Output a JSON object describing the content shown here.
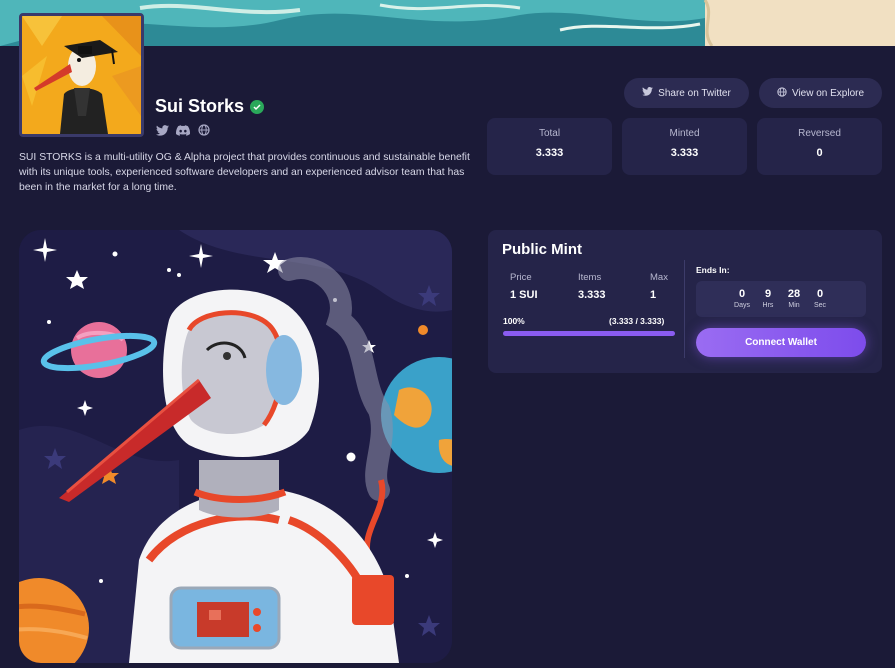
{
  "collection": {
    "name": "Sui Storks",
    "description": "SUI STORKS is a multi-utility OG & Alpha project that provides continuous and sustainable benefit with its unique tools, experienced software developers and an experienced advisor team that has been in the market for a long time.",
    "socials": [
      "twitter-icon",
      "discord-icon",
      "globe-icon"
    ]
  },
  "actions": {
    "share_twitter": "Share on Twitter",
    "view_explore": "View on Explore"
  },
  "stats": {
    "total_label": "Total",
    "total_value": "3.333",
    "minted_label": "Minted",
    "minted_value": "3.333",
    "reversed_label": "Reversed",
    "reversed_value": "0"
  },
  "mint": {
    "title": "Public Mint",
    "price_label": "Price",
    "price_value": "1 SUI",
    "items_label": "Items",
    "items_value": "3.333",
    "max_label": "Max",
    "max_value": "1",
    "progress_percent": "100%",
    "progress_detail": "(3.333 / 3.333)",
    "progress_fraction": 1.0,
    "ends_label": "Ends In:",
    "days_value": "0",
    "days_label": "Days",
    "hrs_value": "9",
    "hrs_label": "Hrs",
    "min_value": "28",
    "min_label": "Min",
    "sec_value": "0",
    "sec_label": "Sec",
    "connect_label": "Connect Wallet"
  },
  "colors": {
    "background": "#1b1a37",
    "card": "#252449",
    "accent": "#8a5cf0",
    "verified": "#2aa85a"
  }
}
